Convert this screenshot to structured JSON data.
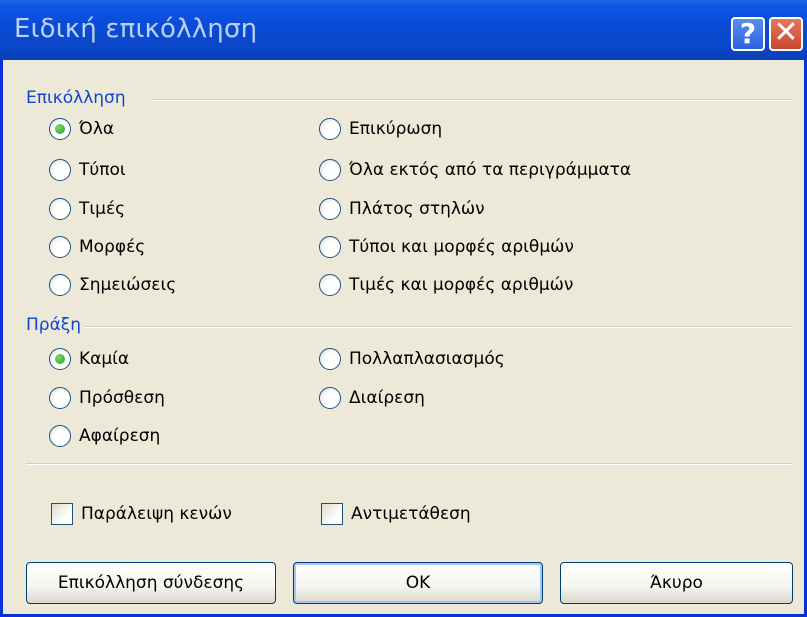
{
  "window": {
    "title": "Ειδική επικόλληση",
    "help_glyph": "?",
    "close_glyph": "✕"
  },
  "paste_group": {
    "label": "Επικόλληση",
    "options": [
      {
        "label": "Όλα",
        "checked": true
      },
      {
        "label": "Τύποι",
        "checked": false
      },
      {
        "label": "Τιμές",
        "checked": false
      },
      {
        "label": "Μορφές",
        "checked": false
      },
      {
        "label": "Σημειώσεις",
        "checked": false
      },
      {
        "label": "Επικύρωση",
        "checked": false
      },
      {
        "label": "Όλα εκτός από τα περιγράμματα",
        "checked": false
      },
      {
        "label": "Πλάτος στηλών",
        "checked": false
      },
      {
        "label": "Τύποι και μορφές αριθμών",
        "checked": false
      },
      {
        "label": "Τιμές και μορφές αριθμών",
        "checked": false
      }
    ]
  },
  "operation_group": {
    "label": "Πράξη",
    "options": [
      {
        "label": "Καμία",
        "checked": true
      },
      {
        "label": "Πρόσθεση",
        "checked": false
      },
      {
        "label": "Αφαίρεση",
        "checked": false
      },
      {
        "label": "Πολλαπλασιασμός",
        "checked": false
      },
      {
        "label": "Διαίρεση",
        "checked": false
      }
    ]
  },
  "checkboxes": {
    "skip_blanks": {
      "label": "Παράλειψη κενών",
      "checked": false
    },
    "transpose": {
      "label": "Αντιμετάθεση",
      "checked": false
    }
  },
  "buttons": {
    "paste_link": "Επικόλληση σύνδεσης",
    "ok": "OK",
    "cancel": "Άκυρο"
  },
  "colors": {
    "titlebar": "#0a46c7",
    "dialog_bg": "#ece9d8",
    "group_label": "#1046d1",
    "radio_dot": "#21a121"
  }
}
